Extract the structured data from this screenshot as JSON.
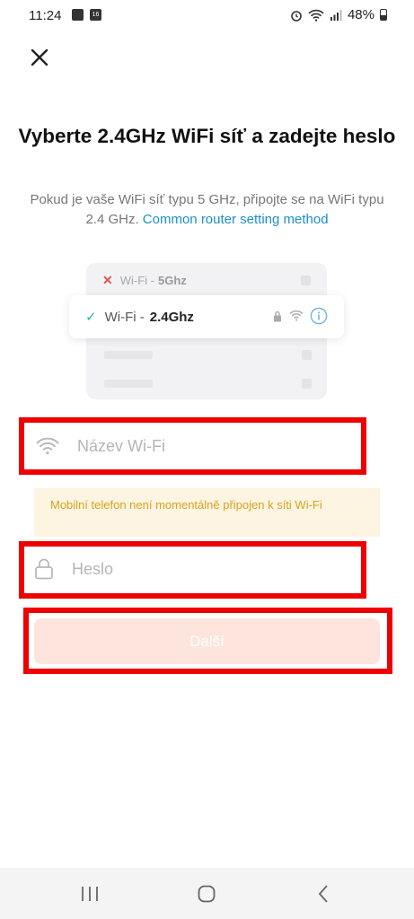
{
  "status_bar": {
    "time": "11:24",
    "calendar_badge": "16",
    "battery": "48%"
  },
  "header": {
    "title": "Vyberte 2.4GHz WiFi síť a zadejte heslo",
    "subtitle_text": "Pokud je vaše WiFi síť typu 5 GHz, připojte se na WiFi typu 2.4 GHz.",
    "subtitle_link": "Common router setting method"
  },
  "illustration": {
    "row_5ghz_prefix": "Wi-Fi -",
    "row_5ghz_band": "5Ghz",
    "row_24ghz_prefix": "Wi-Fi -",
    "row_24ghz_band": "2.4Ghz"
  },
  "form": {
    "wifi_name_placeholder": "Název Wi-Fi",
    "warning": "Mobilní telefon není momentálně připojen k síti Wi-Fi",
    "password_placeholder": "Heslo",
    "next_label": "Další"
  },
  "colors": {
    "accent_link": "#1b8fc9",
    "highlight_red": "#ee0000",
    "warning_text": "#d9a31b",
    "button_disabled_bg": "#fde5dd"
  }
}
